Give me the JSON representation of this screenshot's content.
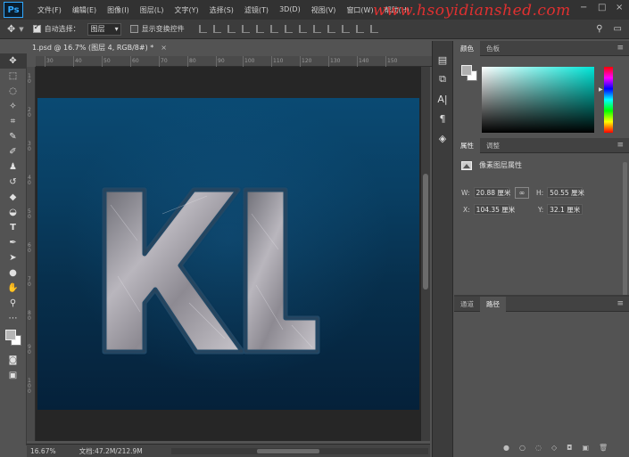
{
  "app": {
    "logo_text": "Ps",
    "menu": [
      "文件(F)",
      "编辑(E)",
      "图像(I)",
      "图层(L)",
      "文字(Y)",
      "选择(S)",
      "滤镜(T)",
      "3D(D)",
      "视图(V)",
      "窗口(W)",
      "帮助(H)"
    ],
    "watermark": "www.hsoyidianshed.com",
    "window_controls": [
      "−",
      "□",
      "×"
    ]
  },
  "options_bar": {
    "auto_select_label": "自动选择：",
    "auto_select_checked": true,
    "auto_select_value": "图层",
    "show_transform_label": "显示变换控件",
    "show_transform_checked": false
  },
  "document": {
    "tab_title": "1.psd @ 16.7% (图层 4, RGB/8#) *",
    "close_glyph": "×",
    "ruler_top_ticks": [
      "30",
      "40",
      "50",
      "60",
      "70",
      "80",
      "90",
      "100",
      "110",
      "120",
      "130",
      "140",
      "150"
    ],
    "ruler_left_ticks": [
      "1\n0",
      "2\n0",
      "3\n0",
      "4\n0",
      "5\n0",
      "6\n0",
      "7\n0",
      "8\n0",
      "9\n0",
      "1\n0\n0"
    ],
    "canvas_text": "KL",
    "colors": {
      "background_top": "#0a4a73",
      "background_bottom": "#05213a",
      "letter_fill": "#9a9aa2",
      "letter_stroke": "#1f4f72"
    }
  },
  "status": {
    "zoom": "16.67%",
    "doc_size": "文档:47.2M/212.9M"
  },
  "panels": {
    "color_tabs": [
      "颜色",
      "色板"
    ],
    "props_tabs": [
      "属性",
      "调整"
    ],
    "props_title": "像素图层属性",
    "w_label": "W:",
    "w_value": "20.88 厘米",
    "h_label": "H:",
    "h_value": "50.55 厘米",
    "x_label": "X:",
    "x_value": "104.35 厘米",
    "y_label": "Y:",
    "y_value": "32.1 厘米",
    "paths_tabs": [
      "通道",
      "路径"
    ],
    "menu_glyph": "≡"
  }
}
